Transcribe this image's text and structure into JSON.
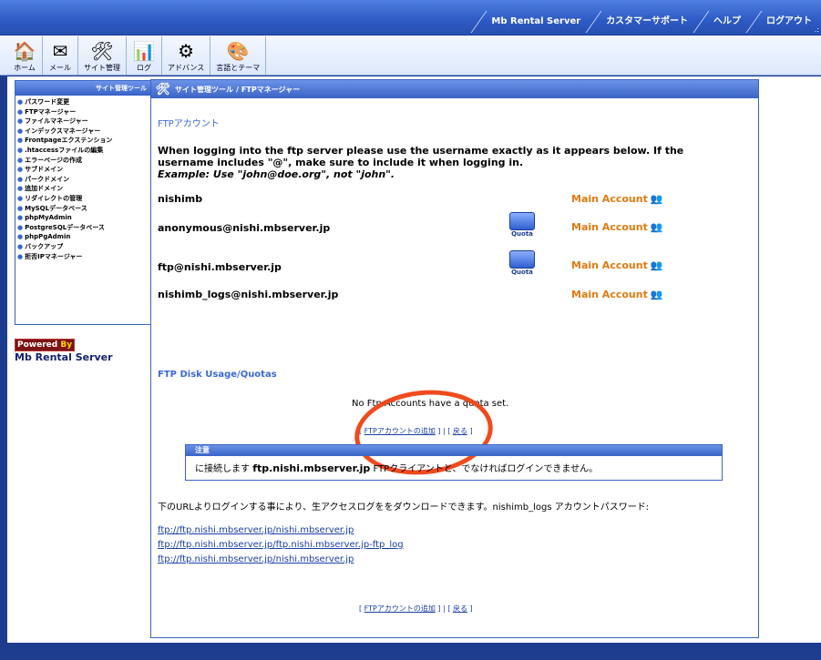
{
  "topnav": {
    "items": [
      "Mb Rental Server",
      "カスタマーサポート",
      "ヘルプ",
      "ログアウト"
    ],
    "corner": ".:"
  },
  "toolbar": {
    "items": [
      {
        "label": "ホーム",
        "icon": "home-icon"
      },
      {
        "label": "メール",
        "icon": "mail-icon"
      },
      {
        "label": "サイト管理",
        "icon": "site-admin-icon"
      },
      {
        "label": "ログ",
        "icon": "log-icon"
      },
      {
        "label": "アドバンス",
        "icon": "advanced-icon"
      },
      {
        "label": "言語とテーマ",
        "icon": "language-theme-icon"
      }
    ]
  },
  "sidebar": {
    "title": "サイト管理ツール",
    "items": [
      "パスワード変更",
      "FTPマネージャー",
      "ファイルマネージャー",
      "インデックスマネージャー",
      "Frontpageエクステンション",
      ".htaccessファイルの編集",
      "エラーページの作成",
      "サブドメイン",
      "パークドメイン",
      "追加ドメイン",
      "リダイレクトの管理",
      "MySQLデータベース",
      "phpMyAdmin",
      "PostgreSQLデータベース",
      "phpPgAdmin",
      "バックアップ",
      "拒否IPマネージャー"
    ]
  },
  "powered": {
    "badge_prefix": "Powered",
    "badge_suffix": "By",
    "name": "Mb Rental Server"
  },
  "main": {
    "breadcrumb_root": "サイト管理ツール",
    "breadcrumb_sep": "/",
    "breadcrumb_current": "FTPマネージャー",
    "ftp_title": "FTPアカウント",
    "notice": "When logging into the ftp server please use the username exactly as it appears below. If the username includes \"@\", make sure to include it when logging in.",
    "notice_example": "Example: Use \"john@doe.org\", not \"john\".",
    "accounts": [
      {
        "name": "nishimb",
        "type": "Main Account",
        "quota": false
      },
      {
        "name": "anonymous@nishi.mbserver.jp",
        "type": "Main Account",
        "quota": true
      },
      {
        "name": "ftp@nishi.mbserver.jp",
        "type": "Main Account",
        "quota": true
      },
      {
        "name": "nishimb_logs@nishi.mbserver.jp",
        "type": "Main Account",
        "quota": false
      }
    ],
    "quota_label": "Quota",
    "usage_title": "FTP Disk Usage/Quotas",
    "usage_msg": "No Ftp Accounts have a quota set.",
    "add_link": "FTPアカウントの追加",
    "back_link": "戻る",
    "warn_title": "注意",
    "warn_pre": "に接続します",
    "warn_host": "ftp.nishi.mbserver.jp",
    "warn_post": "FTPクライアントと、でなければログインできません。",
    "logs_desc": "下のURLよりログインする事により、生アクセスログををダウンロードできます。nishimb_logs アカウントパスワード:",
    "log_links": [
      "ftp://ftp.nishi.mbserver.jp/nishi.mbserver.jp",
      "ftp://ftp.nishi.mbserver.jp/ftp.nishi.mbserver.jp-ftp_log",
      "ftp://ftp.nishi.mbserver.jp/nishi.mbserver.jp"
    ]
  },
  "colors": {
    "accent": "#3a64c2",
    "main_account": "#e07a10",
    "highlight_circle": "#f04a1c"
  }
}
